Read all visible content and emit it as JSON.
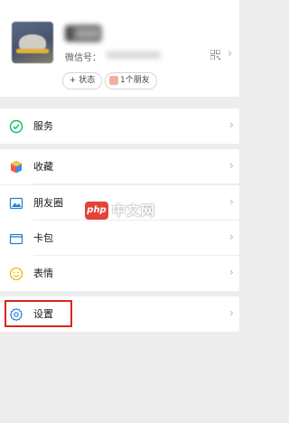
{
  "profile": {
    "wechat_id_label": "微信号：",
    "status_chip": "+ 状态",
    "friends_chip": "1个朋友"
  },
  "menu": {
    "services": "服务",
    "favorites": "收藏",
    "moments": "朋友圈",
    "cards": "卡包",
    "stickers": "表情",
    "settings": "设置"
  },
  "watermark": {
    "badge": "php",
    "text": "中文网"
  },
  "colors": {
    "highlight_border": "#d9261c",
    "services_icon": "#07c160",
    "settings_icon": "#2a7fd4"
  }
}
